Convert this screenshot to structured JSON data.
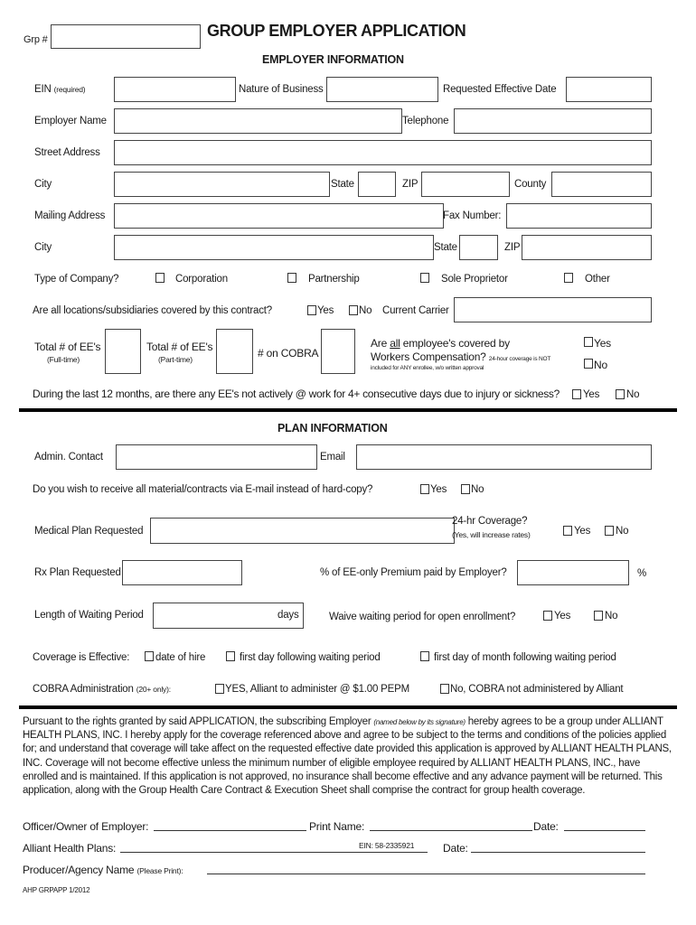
{
  "header": {
    "grp_label": "Grp #",
    "grp_value": "",
    "title": "GROUP EMPLOYER APPLICATION"
  },
  "employer_info": {
    "section_title": "EMPLOYER INFORMATION",
    "ein_label": "EIN",
    "ein_note": "(required)",
    "nature_label": "Nature of Business",
    "effective_date_label": "Requested Effective Date",
    "employer_name_label": "Employer Name",
    "telephone_label": "Telephone",
    "street_label": "Street Address",
    "city_label": "City",
    "state_label": "State",
    "zip_label": "ZIP",
    "county_label": "County",
    "mailing_label": "Mailing Address",
    "fax_label": "Fax Number:",
    "city2_label": "City",
    "state2_label": "State",
    "zip2_label": "ZIP",
    "type_label": "Type of Company?",
    "type_options": [
      "Corporation",
      "Partnership",
      "Sole Proprietor",
      "Other"
    ],
    "locations_question": "Are all locations/subsidiaries covered by this contract?",
    "yes": "Yes",
    "no": "No",
    "current_carrier_label": "Current Carrier",
    "ee_fulltime_label": "Total # of EE's",
    "ee_fulltime_note": "(Full-time)",
    "ee_parttime_label": "Total # of EE's",
    "ee_parttime_note": "(Part-time)",
    "cobra_count_label": "# on COBRA",
    "workers_comp_line1_pre": "Are ",
    "workers_comp_line1_all": "all",
    "workers_comp_line1_post": " employee's covered by",
    "workers_comp_line2": "Workers Compensation?",
    "workers_comp_note1": "24-hour coverage is NOT",
    "workers_comp_note2": "included for ANY enrollee, w/o written approval",
    "absence_question": "During the last 12 months, are there any EE's not actively @ work for 4+ consecutive days due to injury or sickness?"
  },
  "plan_info": {
    "section_title": "PLAN INFORMATION",
    "admin_contact_label": "Admin. Contact",
    "email_label": "Email",
    "email_material_question": "Do you wish to receive all material/contracts via E-mail instead of hard-copy?",
    "medical_plan_label": "Medical Plan Requested",
    "coverage_24hr_label": "24-hr Coverage?",
    "coverage_24hr_note": "(Yes, will increase rates)",
    "rx_plan_label": "Rx Plan Requested",
    "premium_pct_label": "% of EE-only Premium paid by Employer?",
    "pct_symbol": "%",
    "waiting_period_label": "Length of Waiting Period",
    "days_label": "days",
    "waive_question": "Waive waiting period for open enrollment?",
    "coverage_effective_label": "Coverage is Effective:",
    "coverage_effective_options": [
      "date of hire",
      "first day following waiting period",
      "first day of month following waiting period"
    ],
    "cobra_admin_label": "COBRA Administration",
    "cobra_admin_note": "(20+ only):",
    "cobra_yes_option": "YES, Alliant to administer @ $1.00 PEPM",
    "cobra_no_option": "No, COBRA not administered by Alliant"
  },
  "agreement": {
    "text_part1": "Pursuant to the rights granted by said APPLICATION, the subscribing Employer ",
    "text_italic": "(named below by its signature)",
    "text_part2": " hereby agrees to be a group under ALLIANT HEALTH PLANS, INC.  I hereby apply for the coverage referenced above and agree to be subject to the terms and conditions of the policies applied for; and understand that coverage will take affect on the requested effective date provided this application is approved by ALLIANT HEALTH PLANS, INC.  Coverage will not become effective unless the minimum number of eligible employee required by ALLIANT HEALTH PLANS, INC., have enrolled and is maintained.  If this application is not approved, no insurance shall become effective and any advance payment will be returned.  This application, along with the Group Health Care Contract & Execution Sheet shall comprise the contract for group health coverage."
  },
  "signatures": {
    "officer_label": "Officer/Owner of Employer:",
    "print_name_label": "Print Name:",
    "date_label": "Date:",
    "alliant_label": "Alliant Health Plans:",
    "ein_text": "EIN: 58-2335921",
    "date2_label": "Date:",
    "producer_label": "Producer/Agency Name",
    "producer_note": "(Please Print):"
  },
  "footer": {
    "form_code": "AHP GRPAPP 1/2012"
  }
}
